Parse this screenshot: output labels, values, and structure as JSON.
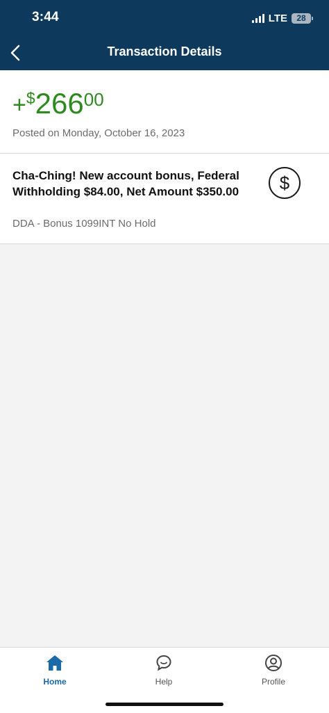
{
  "status_bar": {
    "time": "3:44",
    "network": "LTE",
    "battery": "28"
  },
  "header": {
    "title": "Transaction Details",
    "back_icon": "chevron-left-icon"
  },
  "transaction": {
    "sign": "+",
    "currency": "$",
    "whole": "266",
    "cents": "00",
    "posted": "Posted on Monday, October 16, 2023",
    "description": "Cha-Ching! New account bonus, Federal Withholding $84.00, Net Amount $350.00",
    "sub_description": "DDA - Bonus 1099INT No Hold",
    "category_icon": "dollar-icon",
    "category_icon_glyph": "$"
  },
  "tabs": [
    {
      "label": "Home",
      "icon": "home-icon",
      "active": true
    },
    {
      "label": "Help",
      "icon": "chat-bubble-icon",
      "active": false
    },
    {
      "label": "Profile",
      "icon": "profile-icon",
      "active": false
    }
  ],
  "colors": {
    "header_bg": "#0d3a5c",
    "amount": "#2e8a1e",
    "active_tab": "#1a6aa8"
  }
}
